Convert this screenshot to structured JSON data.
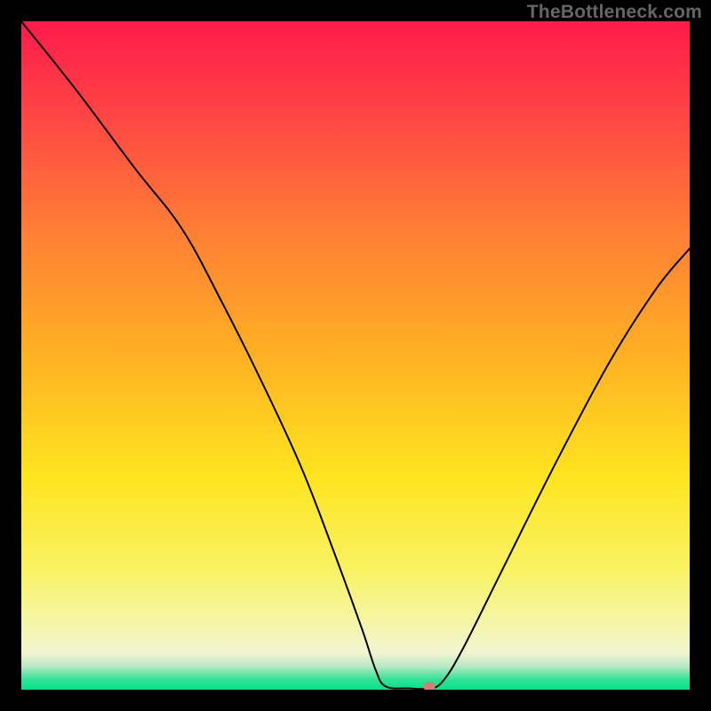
{
  "watermark": "TheBottleneck.com",
  "chart_data": {
    "type": "line",
    "title": "",
    "xlabel": "",
    "ylabel": "",
    "xlim": [
      0,
      100
    ],
    "ylim": [
      0,
      100
    ],
    "grid": false,
    "legend": false,
    "background": {
      "type": "vertical-gradient",
      "stops": [
        {
          "offset": 0,
          "color": "#ff1a4b"
        },
        {
          "offset": 0.12,
          "color": "#ff3f45"
        },
        {
          "offset": 0.3,
          "color": "#ff7a36"
        },
        {
          "offset": 0.5,
          "color": "#ffb123"
        },
        {
          "offset": 0.68,
          "color": "#ffe41f"
        },
        {
          "offset": 0.82,
          "color": "#f8f263"
        },
        {
          "offset": 0.9,
          "color": "#f5f6a8"
        },
        {
          "offset": 0.945,
          "color": "#f3f4d2"
        },
        {
          "offset": 0.965,
          "color": "#b8e9c4"
        },
        {
          "offset": 0.985,
          "color": "#2de495"
        },
        {
          "offset": 1.0,
          "color": "#06e08a"
        }
      ]
    },
    "series": [
      {
        "name": "bottleneck-curve",
        "color": "#000000",
        "stroke_width": 2,
        "points": [
          {
            "x": 0,
            "y": 100
          },
          {
            "x": 8,
            "y": 90
          },
          {
            "x": 17,
            "y": 78
          },
          {
            "x": 24,
            "y": 69
          },
          {
            "x": 30,
            "y": 58
          },
          {
            "x": 36,
            "y": 46
          },
          {
            "x": 42,
            "y": 33
          },
          {
            "x": 47,
            "y": 20
          },
          {
            "x": 51,
            "y": 9
          },
          {
            "x": 53,
            "y": 3
          },
          {
            "x": 54.5,
            "y": 0.5
          },
          {
            "x": 58,
            "y": 0.2
          },
          {
            "x": 61,
            "y": 0.2
          },
          {
            "x": 63,
            "y": 1.2
          },
          {
            "x": 66,
            "y": 6
          },
          {
            "x": 72,
            "y": 18
          },
          {
            "x": 80,
            "y": 34
          },
          {
            "x": 88,
            "y": 49
          },
          {
            "x": 95,
            "y": 60
          },
          {
            "x": 100,
            "y": 66
          }
        ]
      }
    ],
    "marker": {
      "name": "current-point",
      "x": 61,
      "y": 0.5,
      "color": "#d87d71",
      "rx": 7,
      "ry": 5
    }
  }
}
